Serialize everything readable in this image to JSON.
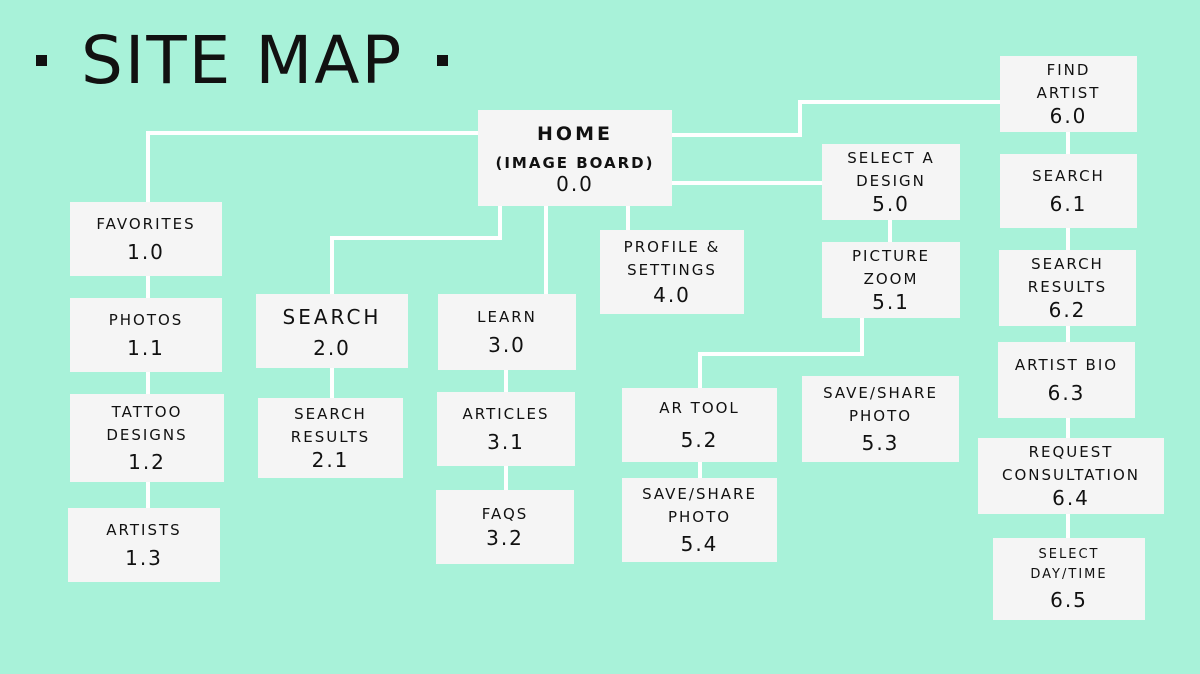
{
  "title": "SITE MAP",
  "colors": {
    "background": "#a8f2d9",
    "box": "#f5f5f5",
    "line": "#ffffff",
    "text": "#111111"
  },
  "nodes": {
    "home": {
      "label": "HOME",
      "sublabel": "(IMAGE BOARD)",
      "number": "0.0"
    },
    "n1_0": {
      "label": "FAVORITES",
      "number": "1.0"
    },
    "n1_1": {
      "label": "PHOTOS",
      "number": "1.1"
    },
    "n1_2": {
      "label": "TATTOO\nDESIGNS",
      "number": "1.2"
    },
    "n1_3": {
      "label": "ARTISTS",
      "number": "1.3"
    },
    "n2_0": {
      "label": "SEARCH",
      "number": "2.0"
    },
    "n2_1": {
      "label": "SEARCH\nRESULTS",
      "number": "2.1"
    },
    "n3_0": {
      "label": "LEARN",
      "number": "3.0"
    },
    "n3_1": {
      "label": "ARTICLES",
      "number": "3.1"
    },
    "n3_2": {
      "label": "FAQS",
      "number": "3.2"
    },
    "n4_0": {
      "label": "PROFILE &\nSETTINGS",
      "number": "4.0"
    },
    "n5_0": {
      "label": "SELECT A\nDESIGN",
      "number": "5.0"
    },
    "n5_1": {
      "label": "PICTURE\nZOOM",
      "number": "5.1"
    },
    "n5_2": {
      "label": "AR TOOL",
      "number": "5.2"
    },
    "n5_3": {
      "label": "SAVE/SHARE\nPHOTO",
      "number": "5.3"
    },
    "n5_4": {
      "label": "SAVE/SHARE\nPHOTO",
      "number": "5.4"
    },
    "n6_0": {
      "label": "FIND\nARTIST",
      "number": "6.0"
    },
    "n6_1": {
      "label": "SEARCH",
      "number": "6.1"
    },
    "n6_2": {
      "label": "SEARCH\nRESULTS",
      "number": "6.2"
    },
    "n6_3": {
      "label": "ARTIST BIO",
      "number": "6.3"
    },
    "n6_4": {
      "label": "REQUEST\nCONSULTATION",
      "number": "6.4"
    },
    "n6_5": {
      "label": "SELECT\nDAY/TIME",
      "number": "6.5"
    }
  }
}
